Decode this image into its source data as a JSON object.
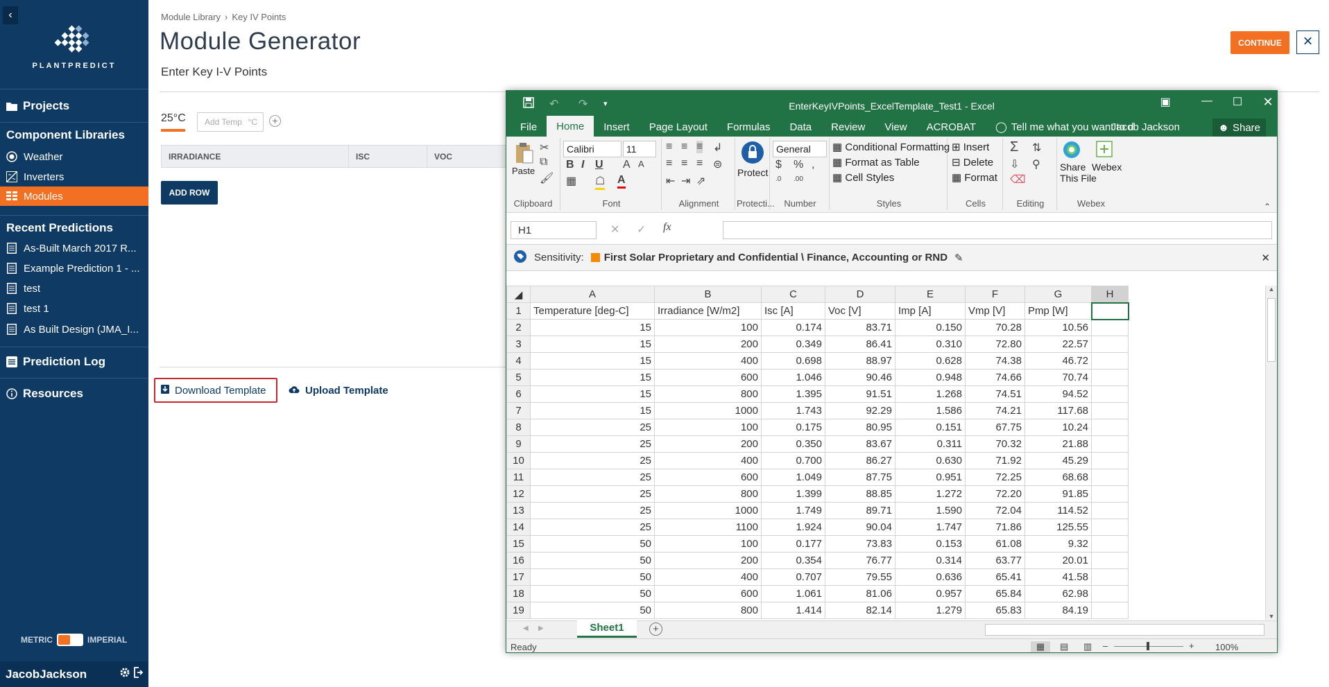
{
  "sidebar": {
    "logo_text": "PLANTPREDICT",
    "projects": "Projects",
    "component_libraries": "Component Libraries",
    "components": [
      {
        "label": "Weather"
      },
      {
        "label": "Inverters"
      },
      {
        "label": "Modules"
      }
    ],
    "recent_predictions_title": "Recent Predictions",
    "recent": [
      {
        "label": "As-Built March 2017 R..."
      },
      {
        "label": "Example Prediction 1 - ..."
      },
      {
        "label": "test"
      },
      {
        "label": "test 1"
      },
      {
        "label": "As Built Design (JMA_I..."
      }
    ],
    "prediction_log": "Prediction Log",
    "resources": "Resources",
    "unit_metric": "METRIC",
    "unit_imperial": "IMPERIAL",
    "username": "JacobJackson"
  },
  "breadcrumb": [
    "Module Library",
    "Key IV Points"
  ],
  "page": {
    "title": "Module Generator",
    "subtitle": "Enter Key I-V Points",
    "continue_label": "CONTINUE",
    "temp_tab": "25°C",
    "temp_placeholder": "Add Temp",
    "temp_unit": "°C",
    "columns": [
      "IRRADIANCE",
      "ISC",
      "VOC"
    ],
    "add_row_label": "ADD ROW",
    "download_label": "Download Template",
    "upload_label": "Upload Template"
  },
  "excel": {
    "title": "EnterKeyIVPoints_ExcelTemplate_Test1 - Excel",
    "menu": [
      "File",
      "Home",
      "Insert",
      "Page Layout",
      "Formulas",
      "Data",
      "Review",
      "View",
      "ACROBAT"
    ],
    "tell_me": "Tell me what you want to d",
    "user": "Jacob Jackson",
    "share": "Share",
    "ribbon": {
      "paste": "Paste",
      "font_name": "Calibri",
      "font_size": "11",
      "protect": "Protect",
      "number_format": "General",
      "conditional_formatting": "Conditional Formatting",
      "format_as_table": "Format as Table",
      "cell_styles": "Cell Styles",
      "insert": "Insert",
      "delete": "Delete",
      "format": "Format",
      "share_this_file_1": "Share",
      "share_this_file_2": "This File",
      "webex": "Webex",
      "groups": [
        "Clipboard",
        "Font",
        "Alignment",
        "Protecti...",
        "Number",
        "Styles",
        "Cells",
        "Editing",
        "Webex"
      ]
    },
    "name_box": "H1",
    "sensitivity_label": "Sensitivity:",
    "sensitivity_value": "First Solar Proprietary and Confidential \\ Finance, Accounting or RND",
    "col_letters": [
      "A",
      "B",
      "C",
      "D",
      "E",
      "F",
      "G",
      "H"
    ],
    "headers": [
      "Temperature [deg-C]",
      "Irradiance [W/m2]",
      "Isc [A]",
      "Voc [V]",
      "Imp [A]",
      "Vmp [V]",
      "Pmp [W]"
    ],
    "rows": [
      [
        "15",
        "100",
        "0.174",
        "83.71",
        "0.150",
        "70.28",
        "10.56"
      ],
      [
        "15",
        "200",
        "0.349",
        "86.41",
        "0.310",
        "72.80",
        "22.57"
      ],
      [
        "15",
        "400",
        "0.698",
        "88.97",
        "0.628",
        "74.38",
        "46.72"
      ],
      [
        "15",
        "600",
        "1.046",
        "90.46",
        "0.948",
        "74.66",
        "70.74"
      ],
      [
        "15",
        "800",
        "1.395",
        "91.51",
        "1.268",
        "74.51",
        "94.52"
      ],
      [
        "15",
        "1000",
        "1.743",
        "92.29",
        "1.586",
        "74.21",
        "117.68"
      ],
      [
        "25",
        "100",
        "0.175",
        "80.95",
        "0.151",
        "67.75",
        "10.24"
      ],
      [
        "25",
        "200",
        "0.350",
        "83.67",
        "0.311",
        "70.32",
        "21.88"
      ],
      [
        "25",
        "400",
        "0.700",
        "86.27",
        "0.630",
        "71.92",
        "45.29"
      ],
      [
        "25",
        "600",
        "1.049",
        "87.75",
        "0.951",
        "72.25",
        "68.68"
      ],
      [
        "25",
        "800",
        "1.399",
        "88.85",
        "1.272",
        "72.20",
        "91.85"
      ],
      [
        "25",
        "1000",
        "1.749",
        "89.71",
        "1.590",
        "72.04",
        "114.52"
      ],
      [
        "25",
        "1100",
        "1.924",
        "90.04",
        "1.747",
        "71.86",
        "125.55"
      ],
      [
        "50",
        "100",
        "0.177",
        "73.83",
        "0.153",
        "61.08",
        "9.32"
      ],
      [
        "50",
        "200",
        "0.354",
        "76.77",
        "0.314",
        "63.77",
        "20.01"
      ],
      [
        "50",
        "400",
        "0.707",
        "79.55",
        "0.636",
        "65.41",
        "41.58"
      ],
      [
        "50",
        "600",
        "1.061",
        "81.06",
        "0.957",
        "65.84",
        "62.98"
      ],
      [
        "50",
        "800",
        "1.414",
        "82.14",
        "1.279",
        "65.83",
        "84.19"
      ]
    ],
    "sheet_tab": "Sheet1",
    "status": "Ready",
    "zoom": "100%"
  },
  "colors": {
    "sidebar": "#0e3a64",
    "accent": "#f36f21",
    "excel_green": "#217346"
  }
}
